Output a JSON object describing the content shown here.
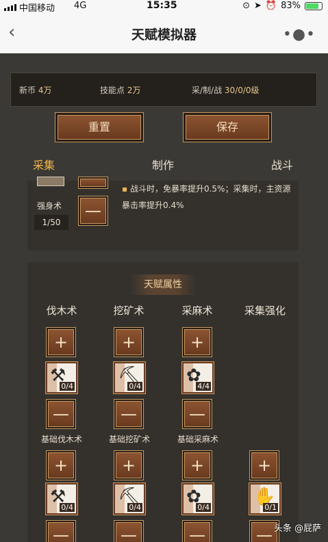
{
  "status_bar": {
    "carrier": "中国移动",
    "network": "4G",
    "time": "15:35",
    "battery": "83%",
    "battery_level": 0.83
  },
  "nav": {
    "back_icon": "chevron-left-icon",
    "title": "天赋模拟器",
    "more_icon": "more-dots-icon"
  },
  "currency": {
    "coin_label": "新币",
    "coin_value": "4万",
    "skill_label": "技能点",
    "skill_value": "2万",
    "levels_label": "采/制/战",
    "levels_value": "30/0/0级"
  },
  "actions": {
    "reset": "重置",
    "save": "保存"
  },
  "tabs": {
    "gather": "采集",
    "craft": "制作",
    "combat": "战斗",
    "active": "gather",
    "accent": "#f0b44a"
  },
  "featured": {
    "name": "强身术",
    "level": "1/50",
    "minus": "—",
    "desc": "战斗时，免暴率提升0.5%；采集时，主资源暴击率提升0.4%"
  },
  "attributes": {
    "title": "天赋属性",
    "columns": [
      {
        "title": "伐木术"
      },
      {
        "title": "挖矿术"
      },
      {
        "title": "采麻术"
      },
      {
        "title": "采集强化"
      }
    ],
    "plus": "+",
    "minus": "—",
    "row1": [
      {
        "label": "基础伐木术",
        "count": "0/4",
        "icon": "axe-icon"
      },
      {
        "label": "基础挖矿术",
        "count": "0/4",
        "icon": "pickaxe-icon"
      },
      {
        "label": "基础采麻术",
        "count": "4/4",
        "icon": "flower-icon"
      }
    ],
    "row2": [
      {
        "count": "0/4",
        "icon": "axe-icon"
      },
      {
        "count": "0/4",
        "icon": "pickaxe-icon"
      },
      {
        "count": "0/4",
        "icon": "flower-icon"
      },
      {
        "count": "0/1",
        "icon": "glove-icon"
      }
    ]
  },
  "watermark": "头条 @屁萨"
}
